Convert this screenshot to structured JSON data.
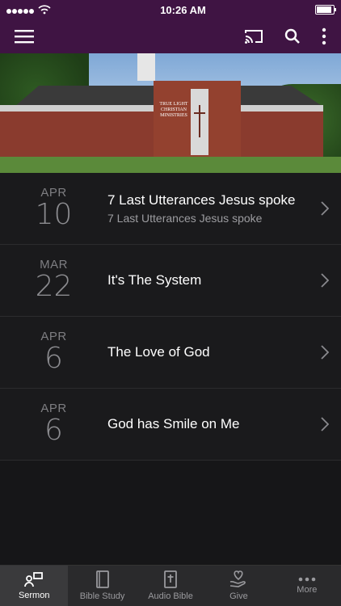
{
  "status_bar": {
    "time": "10:26 AM"
  },
  "app_bar": {
    "menu_icon": "hamburger-menu-icon",
    "cast_icon": "cast-icon",
    "search_icon": "search-icon",
    "more_icon": "vertical-dots-icon"
  },
  "hero": {
    "sign_text": "TRUE LIGHT CHRISTIAN MINISTRIES"
  },
  "sermons": [
    {
      "month": "APR",
      "day": "10",
      "title": "7 Last Utterances Jesus spoke",
      "subtitle": "7 Last Utterances Jesus spoke"
    },
    {
      "month": "MAR",
      "day": "22",
      "title": "It's The System",
      "subtitle": ""
    },
    {
      "month": "APR",
      "day": "6",
      "title": "The Love of God",
      "subtitle": ""
    },
    {
      "month": "APR",
      "day": "6",
      "title": "God has Smile on Me",
      "subtitle": ""
    }
  ],
  "tabs": [
    {
      "label": "Sermon",
      "icon": "sermon-icon",
      "active": true
    },
    {
      "label": "Bible Study",
      "icon": "book-icon",
      "active": false
    },
    {
      "label": "Audio Bible",
      "icon": "bible-cross-icon",
      "active": false
    },
    {
      "label": "Give",
      "icon": "give-heart-hand-icon",
      "active": false
    },
    {
      "label": "More",
      "icon": "more-dots-icon",
      "active": false
    }
  ],
  "colors": {
    "header": "#3f1443",
    "background": "#1a1a1c",
    "tabbar": "#2a2a2c"
  }
}
